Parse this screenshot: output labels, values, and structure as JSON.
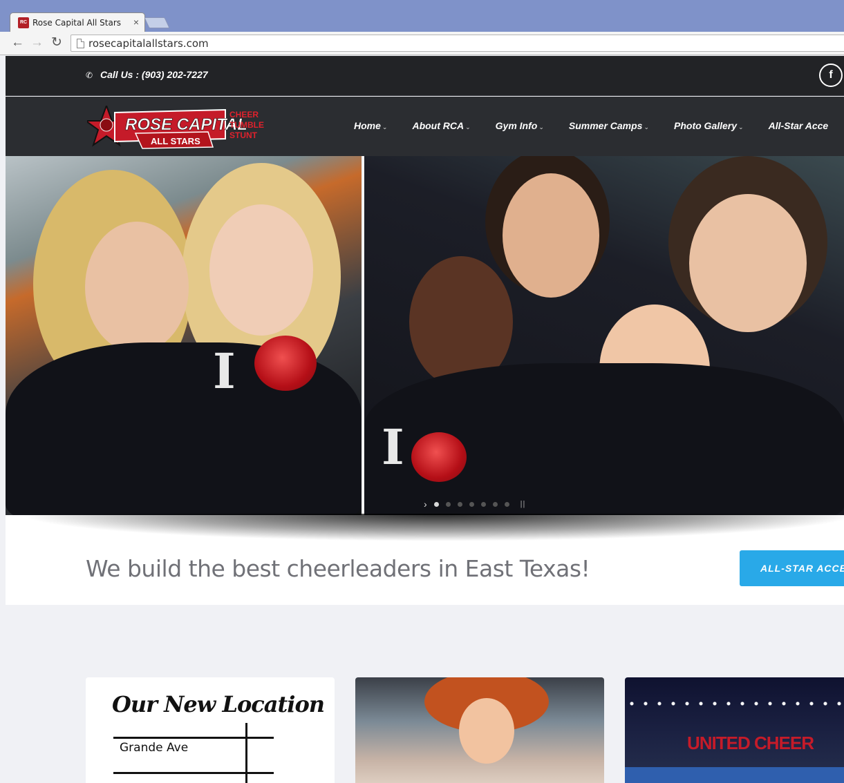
{
  "browser": {
    "tab_title": "Rose Capital All Stars",
    "tab_favicon": "RC",
    "tab_close": "×",
    "url": "rosecapitalallstars.com",
    "back_icon": "arrow-left-icon",
    "forward_icon": "arrow-right-icon",
    "reload_icon": "reload-icon"
  },
  "topbar": {
    "call_text": "Call Us : (903) 202-7227",
    "facebook_label": "f"
  },
  "nav": {
    "items": [
      {
        "label": "Home"
      },
      {
        "label": "About RCA"
      },
      {
        "label": "Gym Info"
      },
      {
        "label": "Summer Camps"
      },
      {
        "label": "Photo Gallery"
      },
      {
        "label": "All-Star Acce"
      }
    ]
  },
  "logo": {
    "name_line1": "ROSE CAPITAL",
    "name_line2": "ALL STARS",
    "tag1": "CHEER",
    "tag2": "TUMBLE",
    "tag3": "STUNT"
  },
  "hero": {
    "shirt_letter_left": "I",
    "shirt_letter_right": "I",
    "slide_count": 7,
    "active_slide": 1
  },
  "tagline": {
    "text": "We build the best cheerleaders in East Texas!",
    "cta_label": "ALL-STAR ACCES"
  },
  "cards": {
    "location_title": "Our New Location",
    "street_name": "Grande Ave",
    "arena_text": "UNITED CHEER"
  },
  "colors": {
    "accent": "#29a9e8",
    "brand_red": "#c51b29",
    "topbar_bg": "#222326",
    "navbar_bg": "#2b2d31"
  }
}
